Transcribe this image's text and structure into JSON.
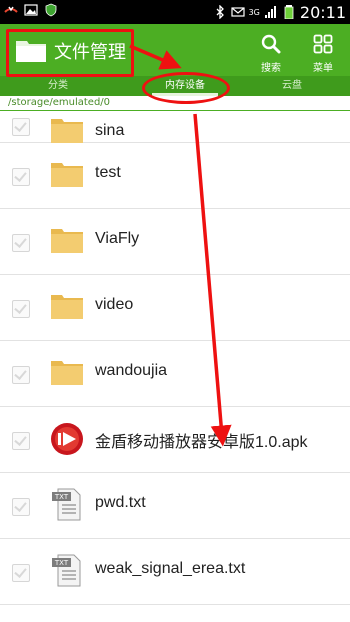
{
  "status_bar": {
    "time": "20:11",
    "network": "3G"
  },
  "app_bar": {
    "title": "文件管理",
    "actions": [
      {
        "label": "搜索",
        "icon": "search-icon"
      },
      {
        "label": "菜单",
        "icon": "menu-grid-icon"
      }
    ]
  },
  "tabs": [
    {
      "label": "分类",
      "active": false
    },
    {
      "label": "内存设备",
      "active": true
    },
    {
      "label": "云盘",
      "active": false
    }
  ],
  "path": "/storage/emulated/0",
  "files": [
    {
      "name": "sina",
      "type": "folder"
    },
    {
      "name": "test",
      "type": "folder"
    },
    {
      "name": "ViaFly",
      "type": "folder"
    },
    {
      "name": "video",
      "type": "folder"
    },
    {
      "name": "wandoujia",
      "type": "folder"
    },
    {
      "name": "金盾移动播放器安卓版1.0.apk",
      "type": "apk"
    },
    {
      "name": "pwd.txt",
      "type": "txt"
    },
    {
      "name": "weak_signal_erea.txt",
      "type": "txt"
    }
  ],
  "colors": {
    "appbar": "#4cae23",
    "tabbar": "#3f9b1c",
    "annotation": "#ee1111",
    "folder": "#f1c867"
  }
}
